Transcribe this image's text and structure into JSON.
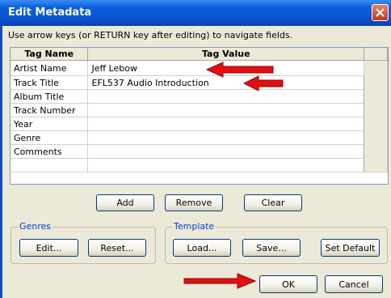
{
  "window": {
    "title": "Edit Metadata"
  },
  "instruction": "Use arrow keys (or RETURN key after editing) to navigate fields.",
  "table": {
    "headers": [
      "Tag Name",
      "Tag Value"
    ],
    "rows": [
      {
        "name": "Artist Name",
        "value": "Jeff Lebow"
      },
      {
        "name": "Track Title",
        "value": "EFL537 Audio Introduction"
      },
      {
        "name": "Album Title",
        "value": ""
      },
      {
        "name": "Track Number",
        "value": ""
      },
      {
        "name": "Year",
        "value": ""
      },
      {
        "name": "Genre",
        "value": ""
      },
      {
        "name": "Comments",
        "value": ""
      }
    ]
  },
  "buttons": {
    "add": "Add",
    "remove": "Remove",
    "clear": "Clear",
    "ok": "OK",
    "cancel": "Cancel"
  },
  "genres": {
    "label": "Genres",
    "edit": "Edit...",
    "reset": "Reset..."
  },
  "template": {
    "label": "Template",
    "load": "Load...",
    "save": "Save...",
    "set_default": "Set Default"
  },
  "colors": {
    "annotation_arrow": "#e01010",
    "title_bar": "#0a5ddd",
    "group_label": "#0046d5"
  }
}
